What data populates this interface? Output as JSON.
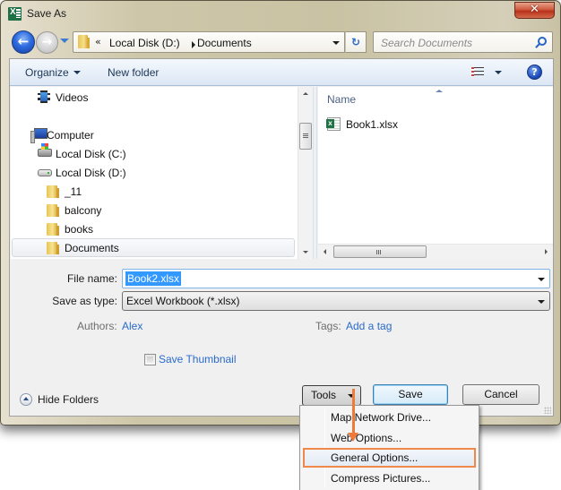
{
  "window": {
    "title": "Save As",
    "close_label": "✕"
  },
  "nav": {
    "back_glyph": "←",
    "forward_glyph": "→",
    "address": {
      "overflow": "«",
      "segments": [
        "Local Disk (D:)",
        "Documents"
      ]
    },
    "refresh_glyph": "↻",
    "search_placeholder": "Search Documents"
  },
  "toolbar": {
    "organize_label": "Organize",
    "new_folder_label": "New folder",
    "help_glyph": "?"
  },
  "nav_pane": {
    "items": [
      {
        "label": "Videos",
        "icon": "videos-icon"
      },
      {
        "label": "Computer",
        "icon": "computer-icon"
      },
      {
        "label": "Local Disk (C:)",
        "icon": "disk-c-icon"
      },
      {
        "label": "Local Disk (D:)",
        "icon": "disk-d-icon"
      },
      {
        "label": "_11",
        "icon": "folder-icon"
      },
      {
        "label": "balcony",
        "icon": "folder-icon"
      },
      {
        "label": "books",
        "icon": "folder-icon"
      },
      {
        "label": "Documents",
        "icon": "folder-icon",
        "selected": true
      }
    ]
  },
  "file_pane": {
    "column_header": "Name",
    "files": [
      {
        "name": "Book1.xlsx",
        "icon": "excel-file-icon"
      }
    ]
  },
  "form": {
    "file_name_label": "File name:",
    "file_name_value": "Book2.xlsx",
    "save_type_label": "Save as type:",
    "save_type_value": "Excel Workbook (*.xlsx)",
    "authors_label": "Authors:",
    "authors_value": "Alex",
    "tags_label": "Tags:",
    "tags_value": "Add a tag",
    "thumbnail_label": "Save Thumbnail",
    "thumbnail_checked": false
  },
  "footer": {
    "hide_folders_label": "Hide Folders",
    "tools_label": "Tools",
    "save_label": "Save",
    "cancel_label": "Cancel"
  },
  "tools_menu": {
    "items": [
      {
        "label": "Map Network Drive..."
      },
      {
        "label": "Web Options..."
      },
      {
        "label": "General Options...",
        "highlighted": true
      },
      {
        "label": "Compress Pictures..."
      }
    ],
    "highlight_color": "#f0884a"
  }
}
